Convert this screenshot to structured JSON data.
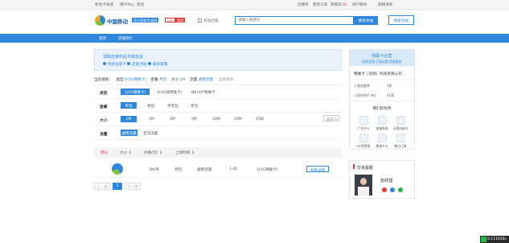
{
  "topbar": {
    "left_links": [
      "移动卡商城",
      "用户中心",
      "退出"
    ],
    "right_links": [
      "优惠券",
      "我的订单",
      "购物车",
      "商户服务",
      "购物清单"
    ],
    "cart_count": "(0)"
  },
  "header": {
    "logo": "中国移动",
    "logo_badge": "官方授权专卖网",
    "logo_tag": "VIP",
    "logo_tag2": "商家",
    "mobile_shop": "移动店铺",
    "search_placeholder": "请输入关键词",
    "search_button": "搜索本站",
    "search_all_button": "搜索全站"
  },
  "nav": {
    "items": [
      "首页",
      "店铺简介"
    ]
  },
  "promo": {
    "title": "领取店家商品专属权益",
    "items": [
      "购买任意卡",
      "店铺活动",
      "联系客服"
    ]
  },
  "current_search": {
    "label": "当前搜索：",
    "filters": [
      {
        "key": "类型:",
        "value": "1(5G物联卡)"
      },
      {
        "key": "套餐:",
        "value": "月包"
      },
      {
        "key": "大小:",
        "value": "2M"
      },
      {
        "key": "流量:",
        "value": "通用流量"
      }
    ],
    "clear": "全部清除"
  },
  "filters": {
    "type": {
      "label": "类型",
      "options": [
        "1(5G物联卡)",
        "1(5G速物联卡)",
        "NB-IOT物联卡"
      ],
      "selected": 0
    },
    "package": {
      "label": "套餐",
      "options": [
        "月包",
        "季包",
        "半年包",
        "年包"
      ],
      "selected": 0
    },
    "size": {
      "label": "大小",
      "options": [
        "2M",
        "3M",
        "4M",
        "5M",
        "10M",
        "20M",
        "15M"
      ],
      "selected": 0,
      "more": "展开"
    },
    "traffic": {
      "label": "流量",
      "options": [
        "通用流量",
        "定向流量"
      ],
      "selected": 0
    }
  },
  "sort": {
    "items": [
      "默认",
      "大小",
      "价格(元)",
      "上架时间"
    ]
  },
  "product": {
    "size": "2M/月",
    "package": "月包",
    "traffic": "通用流量",
    "price": "1.40",
    "type": "1(5G物联卡)",
    "button": "查看详情"
  },
  "pagination": {
    "prev": "上一页",
    "current": "1",
    "next": "下一页"
  },
  "store": {
    "banner_title": "物联卡台营",
    "banner_sub": "优质资源 正规运营 优惠服务",
    "name": "物联卡（深圳）科技有限公司",
    "stats": [
      {
        "k": "入驻进度率",
        "v": "3家"
      },
      {
        "k": "入驻时间(广州)",
        "v": "21家"
      }
    ],
    "advantages_title": "我们的优势",
    "advantages": [
      "广东开卡",
      "加速系统",
      "无理由退卡",
      "VIP免费享",
      "稳源不卡",
      "售后订单"
    ]
  },
  "service": {
    "title": "交易客服",
    "name": "张经理"
  },
  "status": {
    "value": "0.111036s"
  },
  "colors": {
    "accent": "#2f87dc",
    "red": "#e03b3b",
    "bg_light": "#eaf2fb"
  }
}
